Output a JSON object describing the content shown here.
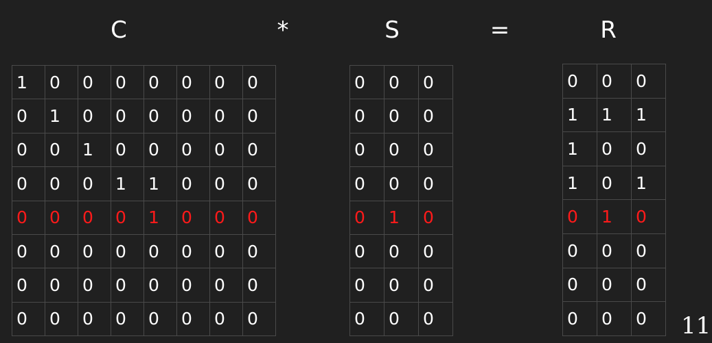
{
  "header": {
    "left": "C",
    "operator_1": "*",
    "middle": "S",
    "operator_2": "=",
    "right": "R"
  },
  "matrices": {
    "c": {
      "highlight_row": 4,
      "rows": [
        [
          "1",
          "0",
          "0",
          "0",
          "0",
          "0",
          "0",
          "0"
        ],
        [
          "0",
          "1",
          "0",
          "0",
          "0",
          "0",
          "0",
          "0"
        ],
        [
          "0",
          "0",
          "1",
          "0",
          "0",
          "0",
          "0",
          "0"
        ],
        [
          "0",
          "0",
          "0",
          "1",
          "1",
          "0",
          "0",
          "0"
        ],
        [
          "0",
          "0",
          "0",
          "0",
          "1",
          "0",
          "0",
          "0"
        ],
        [
          "0",
          "0",
          "0",
          "0",
          "0",
          "0",
          "0",
          "0"
        ],
        [
          "0",
          "0",
          "0",
          "0",
          "0",
          "0",
          "0",
          "0"
        ],
        [
          "0",
          "0",
          "0",
          "0",
          "0",
          "0",
          "0",
          "0"
        ]
      ]
    },
    "s": {
      "highlight_row": 4,
      "rows": [
        [
          "0",
          "0",
          "0"
        ],
        [
          "0",
          "0",
          "0"
        ],
        [
          "0",
          "0",
          "0"
        ],
        [
          "0",
          "0",
          "0"
        ],
        [
          "0",
          "1",
          "0"
        ],
        [
          "0",
          "0",
          "0"
        ],
        [
          "0",
          "0",
          "0"
        ],
        [
          "0",
          "0",
          "0"
        ]
      ]
    },
    "r": {
      "highlight_row": 4,
      "rows": [
        [
          "0",
          "0",
          "0"
        ],
        [
          "1",
          "1",
          "1"
        ],
        [
          "1",
          "0",
          "0"
        ],
        [
          "1",
          "0",
          "1"
        ],
        [
          "0",
          "1",
          "0"
        ],
        [
          "0",
          "0",
          "0"
        ],
        [
          "0",
          "0",
          "0"
        ],
        [
          "0",
          "0",
          "0"
        ]
      ]
    }
  },
  "highlight_color": "#ff1a1a",
  "page_number": "11"
}
